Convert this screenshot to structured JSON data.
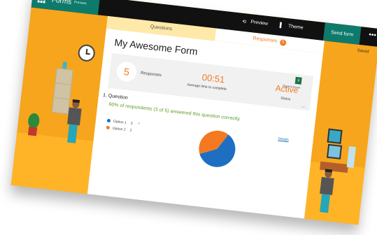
{
  "app": {
    "name": "Forms",
    "badge": "Preview"
  },
  "topbar": {
    "preview_label": "Preview",
    "theme_label": "Theme",
    "send_label": "Send form",
    "more_label": "•••"
  },
  "status_text": "Saved",
  "tabs": {
    "questions": "Questions",
    "responses": "Responses",
    "responses_badge": "5"
  },
  "form": {
    "title": "My Awesome Form"
  },
  "summary": {
    "responses_count": "5",
    "responses_label": "Responses",
    "avg_time": "00:51",
    "avg_time_label": "Average time to complete",
    "status": "Active",
    "status_label": "Status",
    "excel_label": "Open in Excel",
    "more_label": "..."
  },
  "question": {
    "title": "1. Question",
    "summary": "60% of respondents (3 of 5) answered this question correctly.",
    "details_label": "Details",
    "options": [
      {
        "label": "Option 1",
        "count": "3",
        "correct_mark": "✓",
        "color": "#1e6fc2"
      },
      {
        "label": "Option 2",
        "count": "2",
        "correct_mark": "",
        "color": "#f47920"
      }
    ]
  },
  "chart_data": {
    "type": "pie",
    "categories": [
      "Option 1",
      "Option 2"
    ],
    "values": [
      3,
      2
    ],
    "colors": [
      "#1e6fc2",
      "#f47920"
    ]
  }
}
